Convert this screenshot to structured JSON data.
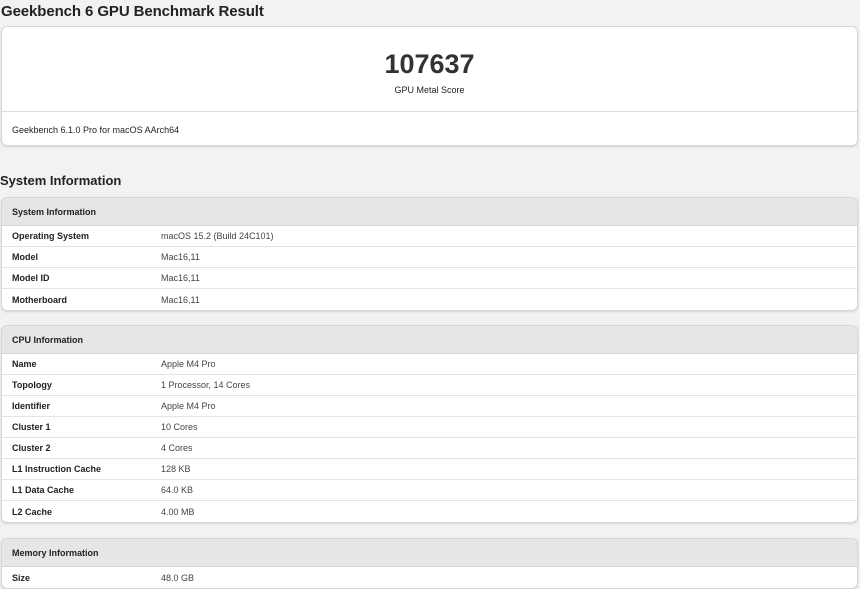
{
  "page": {
    "title": "Geekbench 6 GPU Benchmark Result"
  },
  "score": {
    "value": "107637",
    "label": "GPU Metal Score",
    "version": "Geekbench 6.1.0 Pro for macOS AArch64"
  },
  "system_section": {
    "heading": "System Information"
  },
  "system_info": {
    "title": "System Information",
    "rows": [
      {
        "label": "Operating System",
        "value": "macOS 15.2 (Build 24C101)"
      },
      {
        "label": "Model",
        "value": "Mac16,11"
      },
      {
        "label": "Model ID",
        "value": "Mac16,11"
      },
      {
        "label": "Motherboard",
        "value": "Mac16,11"
      }
    ]
  },
  "cpu_info": {
    "title": "CPU Information",
    "rows": [
      {
        "label": "Name",
        "value": "Apple M4 Pro"
      },
      {
        "label": "Topology",
        "value": "1 Processor, 14 Cores"
      },
      {
        "label": "Identifier",
        "value": "Apple M4 Pro"
      },
      {
        "label": "Cluster 1",
        "value": "10 Cores"
      },
      {
        "label": "Cluster 2",
        "value": "4 Cores"
      },
      {
        "label": "L1 Instruction Cache",
        "value": "128 KB"
      },
      {
        "label": "L1 Data Cache",
        "value": "64.0 KB"
      },
      {
        "label": "L2 Cache",
        "value": "4.00 MB"
      }
    ]
  },
  "memory_info": {
    "title": "Memory Information",
    "rows": [
      {
        "label": "Size",
        "value": "48.0 GB"
      }
    ]
  }
}
